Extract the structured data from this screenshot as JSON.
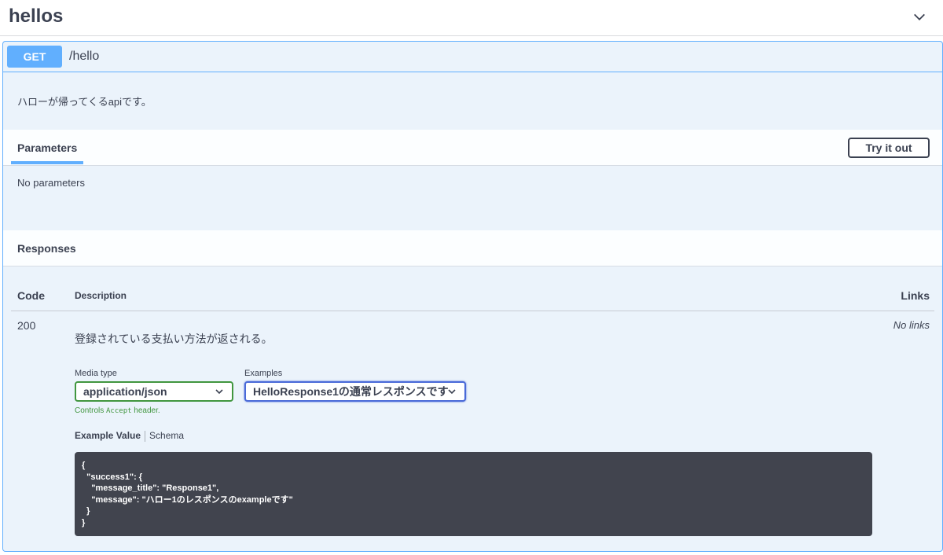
{
  "tag": {
    "title": "hellos",
    "chevron_icon": "chevron-down-icon"
  },
  "operation": {
    "method": "GET",
    "path": "/hello",
    "description": "ハローが帰ってくるapiです。"
  },
  "parameters": {
    "title": "Parameters",
    "try_label": "Try it out",
    "empty_text": "No parameters"
  },
  "responses": {
    "title": "Responses",
    "columns": {
      "code": "Code",
      "description": "Description",
      "links": "Links"
    },
    "rows": [
      {
        "code": "200",
        "description": "登録されている支払い方法が返される。",
        "links": "No links",
        "media_type_label": "Media type",
        "media_type_value": "application/json",
        "examples_label": "Examples",
        "examples_value": "HelloResponse1の通常レスポンスです",
        "controls_prefix": "Controls ",
        "controls_code": "Accept",
        "controls_suffix": " header.",
        "tab_example": "Example Value",
        "tab_schema": "Schema",
        "example_json": "{\n  \"success1\": {\n    \"message_title\": \"Response1\",\n    \"message\": \"ハロー1のレスポンスのexampleです\"\n  }\n}"
      }
    ]
  },
  "colors": {
    "get_blue": "#61affe",
    "success_green": "#41963f",
    "focus_blue": "#4a6ad8",
    "code_bg": "#41444e",
    "text": "#3b4151"
  }
}
